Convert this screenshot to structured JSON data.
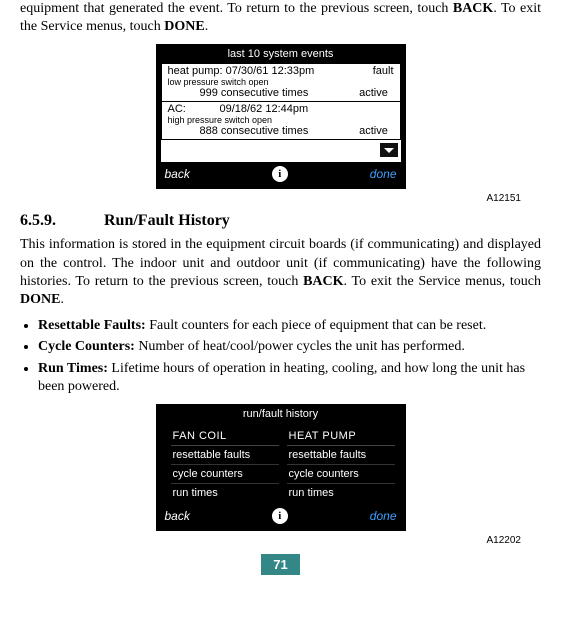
{
  "intro": {
    "text_pre": "equipment that generated the event. To return to the previous screen, touch ",
    "back_bold": "BACK",
    "text_mid": ". To exit the Service menus, touch ",
    "done_bold": "DONE",
    "text_end": "."
  },
  "screen1": {
    "title": "last 10 system events",
    "events": [
      {
        "name_date": "heat pump: 07/30/61 12:33pm",
        "type": "fault",
        "detail": "low pressure switch open",
        "count": "999 consecutive times",
        "status": "active"
      },
      {
        "name_date": "AC:           09/18/62 12:44pm",
        "type": "",
        "detail": "high pressure switch open",
        "count": "888 consecutive times",
        "status": "active"
      }
    ],
    "back": "back",
    "done": "done",
    "info": "i",
    "fig_id": "A12151"
  },
  "section": {
    "number": "6.5.9.",
    "title": "Run/Fault History",
    "para_pre": "This information is stored in the equipment circuit boards (if communicating) and displayed on the control. The indoor unit and outdoor unit (if communicating) have the following histories. To return to the previous screen, touch ",
    "back_bold": "BACK",
    "para_mid": ". To exit the Service menus, touch ",
    "done_bold": "DONE",
    "para_end": ".",
    "bullets": [
      {
        "term": "Resettable Faults:",
        "desc": " Fault counters for each piece of equipment that can be reset."
      },
      {
        "term": "Cycle Counters:",
        "desc": " Number of heat/cool/power cycles the unit has performed."
      },
      {
        "term": "Run Times:",
        "desc": " Lifetime hours of operation in heating, cooling, and how long the unit has been powered."
      }
    ]
  },
  "screen2": {
    "title": "run/fault history",
    "cols": [
      {
        "head": "FAN COIL",
        "items": [
          "resettable faults",
          "cycle counters",
          "run times"
        ]
      },
      {
        "head": "HEAT PUMP",
        "items": [
          "resettable faults",
          "cycle counters",
          "run times"
        ]
      }
    ],
    "back": "back",
    "done": "done",
    "info": "i",
    "fig_id": "A12202"
  },
  "page_number": "71"
}
